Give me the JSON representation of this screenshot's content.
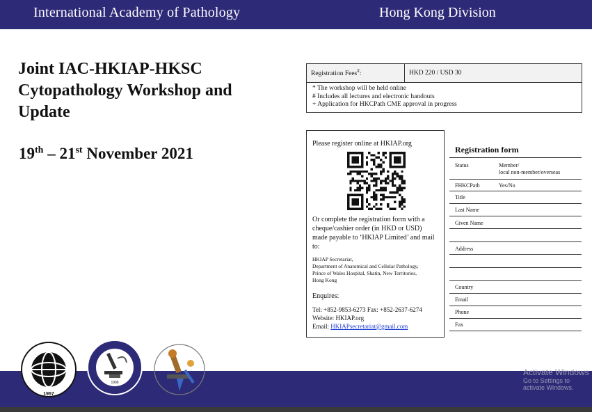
{
  "header": {
    "left": "International Academy of  Pathology",
    "right": "Hong Kong Division"
  },
  "event": {
    "title_line1": "Joint IAC-HKIAP-HKSC",
    "title_line2": "Cytopathology Workshop and",
    "title_line3": "Update",
    "date_day1": "19",
    "date_sup1": "th",
    "date_dash": " – ",
    "date_day2": "21",
    "date_sup2": "st",
    "date_rest": " November 2021"
  },
  "fees": {
    "label": "Registration Fees",
    "label_mark": "#",
    "label_colon": ":",
    "value": "HKD 220 / USD 30",
    "notes": [
      "* The workshop will be held online",
      "# Includes all lectures and electronic handouts",
      "+ Application for HKCPath CME approval in progress"
    ]
  },
  "registration": {
    "online_text": "Please register online at HKIAP.org",
    "complete_text": "Or complete the registration form with a cheque/cashier order (in HKD or USD) made payable to ‘HKIAP Limited’ and mail to:",
    "address_lines": [
      "HKIAP Secretariat,",
      "Department of Anatomical and Cellular Pathology,",
      "Prince of Wales Hospital, Shatin, New Territories,",
      "Hong Kong"
    ],
    "enquiries": "Enquires:",
    "tel": "Tel: +852-9853-6273   Fax: +852-2637-6274",
    "website": "Website: HKIAP.org",
    "email_prefix": "Email: ",
    "email": "HKIAPsecretariat@gmail.com"
  },
  "form": {
    "title": "Registration form",
    "status_label": "Status",
    "status_value_1": "Member/",
    "status_value_2": "local non-member/overseas",
    "fhkcpath_label": "FHKCPath",
    "fhkcpath_value": "Yes/No",
    "title_label": "Title",
    "last_name": "Last Name",
    "given_name": "Given Name",
    "address": "Address",
    "country": "Country",
    "email": "Email",
    "phone": "Phone",
    "fax": "Fax"
  },
  "logos": [
    {
      "name": "International Academy of Cytology",
      "year": "1957"
    },
    {
      "name": "International Academy of Pathology",
      "year": "1906"
    },
    {
      "name": "Hong Kong Society of Cytology"
    }
  ],
  "watermark": {
    "line1": "Activate Windows",
    "line2": "Go to Settings to activate Windows."
  },
  "colors": {
    "banner": "#2d2a78",
    "link": "#1d3bd6"
  }
}
